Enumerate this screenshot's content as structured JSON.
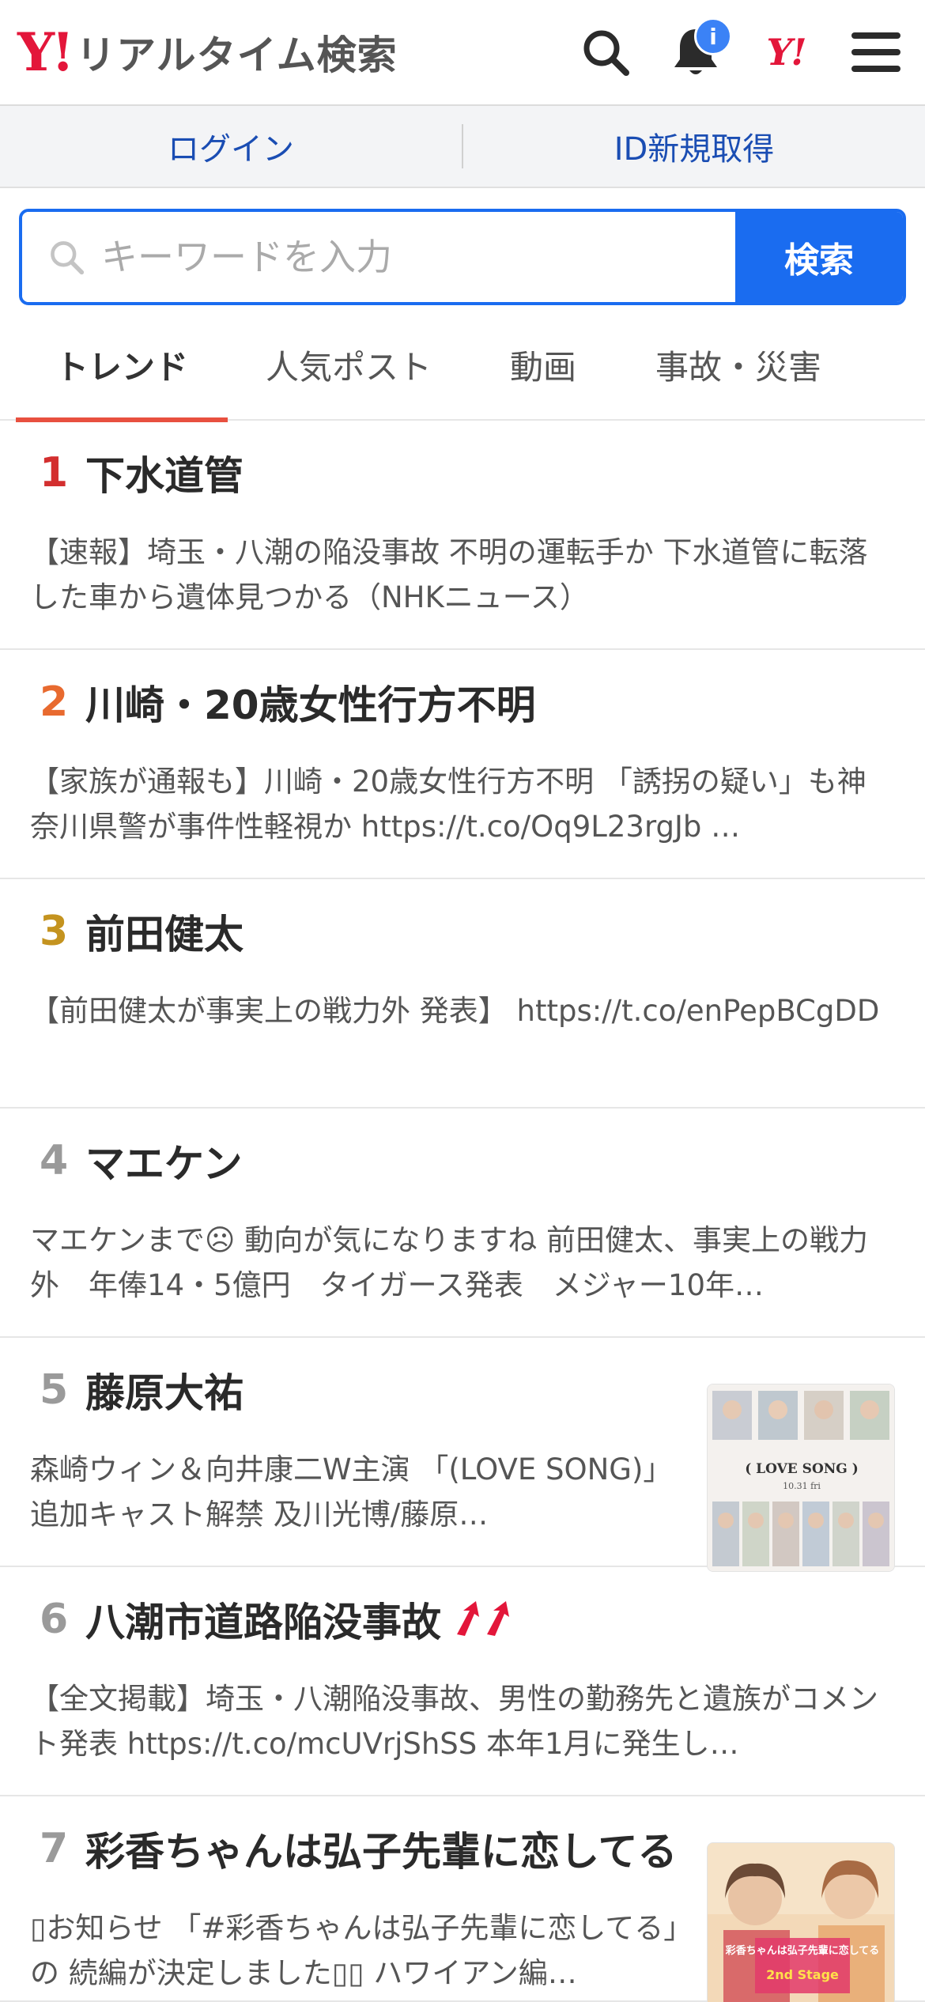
{
  "header": {
    "logo_mark": "Y!",
    "logo_text": "リアルタイム検索",
    "notification_badge": "i",
    "yj_logo": "Y!"
  },
  "login_bar": {
    "login": "ログイン",
    "signup": "ID新規取得"
  },
  "search": {
    "placeholder": "キーワードを入力",
    "button": "検索"
  },
  "tabs": [
    "トレンド",
    "人気ポスト",
    "動画",
    "事故・災害"
  ],
  "trends": [
    {
      "rank": "1",
      "title": "下水道管",
      "desc": "【速報】埼玉・八潮の陥没事故 不明の運転手か 下水道管に転落した車から遺体見つかる（NHKニュース）"
    },
    {
      "rank": "2",
      "title": "川崎・20歳女性行方不明",
      "desc": "【家族が通報も】川崎・20歳女性行方不明 「誘拐の疑い」も神奈川県警が事件性軽視か https://t.co/Oq9L23rgJb …"
    },
    {
      "rank": "3",
      "title": "前田健太",
      "desc": "【前田健太が事実上の戦力外 発表】 https://t.co/enPepBCgDD"
    },
    {
      "rank": "4",
      "title": "マエケン",
      "desc": "マエケンまで☹ 動向が気になりますね 前田健太、事実上の戦力外　年俸14・5億円　タイガース発表　メジャー10年…"
    },
    {
      "rank": "5",
      "title": "藤原大祐",
      "desc": "森崎ウィン＆向井康二W主演 「(LOVE SONG)」追加キャスト解禁 及川光博/藤原…",
      "thumb_text": "( LOVE SONG )",
      "thumb_sub": "10.31 fri"
    },
    {
      "rank": "6",
      "title": "八潮市道路陥没事故",
      "desc": "【全文掲載】埼玉・八潮陥没事故、男性の勤務先と遺族がコメント発表 https://t.co/mcUVrjShSS 本年1月に発生し…"
    },
    {
      "rank": "7",
      "title": "彩香ちゃんは弘子先輩に恋してる",
      "desc": "▯お知らせ 「#彩香ちゃんは弘子先輩に恋してる」の 続編が決定しました▯▯ ハワイアン編…",
      "thumb_text": "彩香ちゃんは弘子先輩に恋してる",
      "thumb_sub": "2nd Stage"
    }
  ],
  "colors": {
    "brand_red": "#e3163a",
    "accent_blue": "#1a6cf0",
    "tab_underline": "#e8503f",
    "rank1": "#d32f2f",
    "rank2": "#e86a2f",
    "rank3": "#c4931f"
  },
  "icons": [
    "search-icon",
    "bell-icon",
    "menu-icon",
    "magnifier-icon",
    "rising-arrows-icon"
  ]
}
